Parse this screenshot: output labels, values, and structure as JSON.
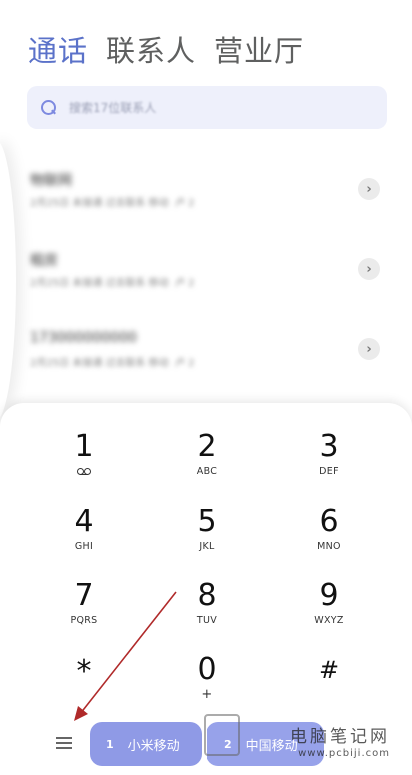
{
  "tabs": [
    {
      "label": "通话",
      "active": true
    },
    {
      "label": "联系人",
      "active": false
    },
    {
      "label": "营业厅",
      "active": false
    }
  ],
  "search": {
    "placeholder": "搜索17位联系人",
    "icon": "search-icon"
  },
  "call_log": [
    {
      "name": "物联网",
      "meta": "2月25日 未接通 过去联系 移动",
      "badge": "卢 2"
    },
    {
      "name": "租房",
      "meta": "2月25日 未接通 过去联系 移动",
      "badge": "卢 2"
    },
    {
      "name": "173000000000",
      "meta": "2月25日 未接通 过去联系 移动",
      "badge": "卢 2"
    }
  ],
  "dialpad": {
    "keys": [
      {
        "digit": "1",
        "letters": "",
        "voicemail": true
      },
      {
        "digit": "2",
        "letters": "ABC"
      },
      {
        "digit": "3",
        "letters": "DEF"
      },
      {
        "digit": "4",
        "letters": "GHI"
      },
      {
        "digit": "5",
        "letters": "JKL"
      },
      {
        "digit": "6",
        "letters": "MNO"
      },
      {
        "digit": "7",
        "letters": "PQRS"
      },
      {
        "digit": "8",
        "letters": "TUV"
      },
      {
        "digit": "9",
        "letters": "WXYZ"
      },
      {
        "digit": "*",
        "letters": ""
      },
      {
        "digit": "0",
        "letters": "+"
      },
      {
        "digit": "#",
        "letters": ""
      }
    ]
  },
  "bottom_bar": {
    "sim1": {
      "num": "1",
      "label": "小米移动"
    },
    "sim2": {
      "num": "2",
      "label": "中国移动"
    }
  },
  "watermark": {
    "title": "电脑笔记网",
    "url": "www.pcbiji.com"
  },
  "colors": {
    "accent": "#5b72c9",
    "sim_button": "#8f9ae6",
    "annotation_arrow": "#b02a2a"
  }
}
